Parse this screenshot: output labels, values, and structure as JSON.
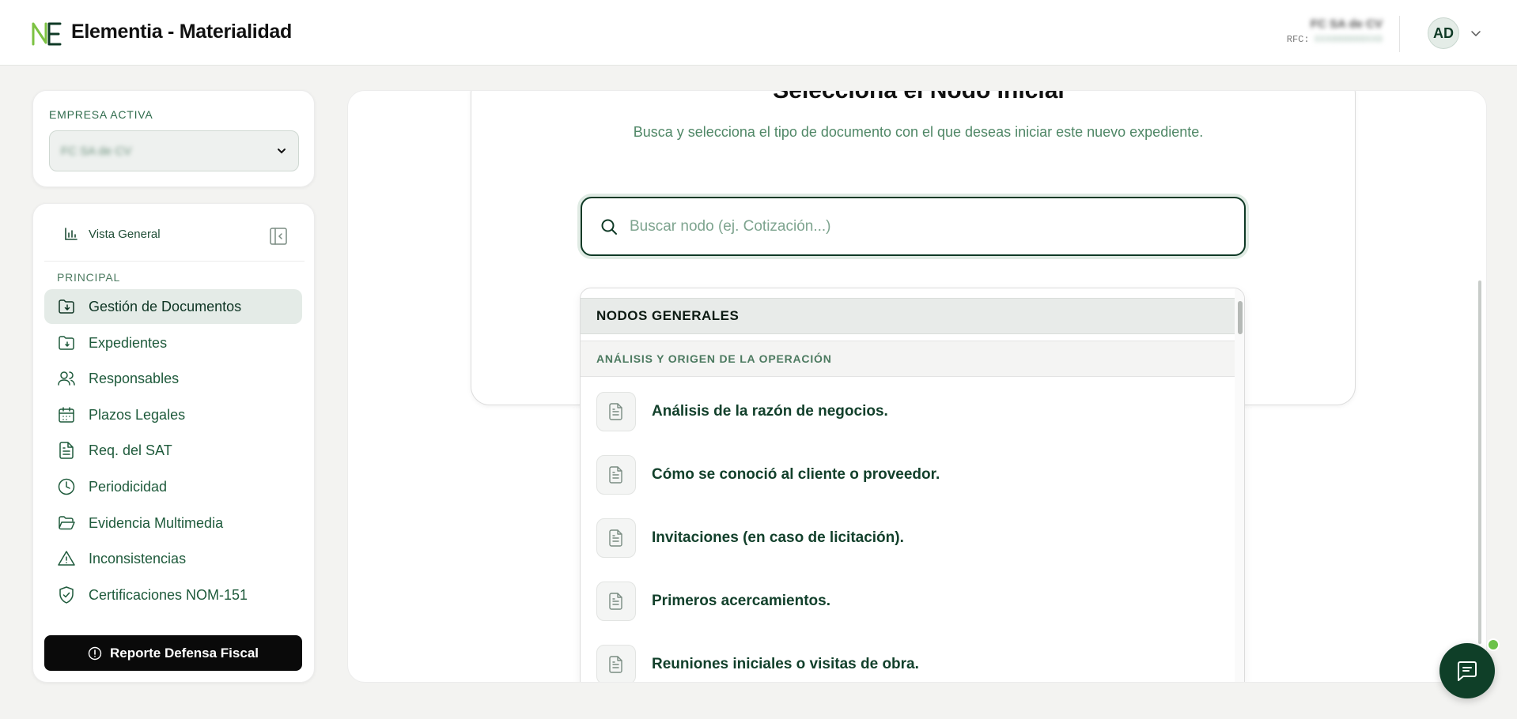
{
  "header": {
    "app_title": "Elementia - Materialidad",
    "company_name": "FC SA de CV",
    "rfc_label": "RFC:",
    "rfc_value": "XXX000000XX0",
    "avatar_initials": "AD"
  },
  "empresa": {
    "label": "EMPRESA ACTIVA",
    "selected": "FC SA de CV"
  },
  "sidebar": {
    "vista_general": "Vista General",
    "section_label": "PRINCIPAL",
    "items": [
      {
        "label": "Gestión de Documentos",
        "icon": "folder-download-icon",
        "active": true
      },
      {
        "label": "Expedientes",
        "icon": "folder-icon",
        "active": false
      },
      {
        "label": "Responsables",
        "icon": "users-icon",
        "active": false
      },
      {
        "label": "Plazos Legales",
        "icon": "calendar-icon",
        "active": false
      },
      {
        "label": "Req. del SAT",
        "icon": "document-icon",
        "active": false
      },
      {
        "label": "Periodicidad",
        "icon": "clock-icon",
        "active": false
      },
      {
        "label": "Evidencia Multimedia",
        "icon": "folder-open-icon",
        "active": false
      },
      {
        "label": "Inconsistencias",
        "icon": "warning-icon",
        "active": false
      },
      {
        "label": "Certificaciones NOM-151",
        "icon": "shield-check-icon",
        "active": false
      }
    ],
    "reporte_button": "Reporte Defensa Fiscal"
  },
  "main": {
    "title": "Selecciona el Nodo Inicial",
    "subtitle": "Busca y selecciona el tipo de documento con el que deseas iniciar este nuevo expediente.",
    "search": {
      "placeholder": "Buscar nodo (ej. Cotización...)",
      "value": ""
    },
    "dropdown": {
      "group": "NODOS GENERALES",
      "subgroup": "ANÁLISIS Y ORIGEN DE LA OPERACIÓN",
      "items": [
        "Análisis de la razón de negocios.",
        "Cómo se conoció al cliente o proveedor.",
        "Invitaciones (en caso de licitación).",
        "Primeros acercamientos.",
        "Reuniones iniciales o visitas de obra."
      ]
    }
  },
  "colors": {
    "brand_dark_green": "#0f3a26",
    "accent_green": "#6cc24a",
    "active_item_bg": "#e4ebe7"
  }
}
